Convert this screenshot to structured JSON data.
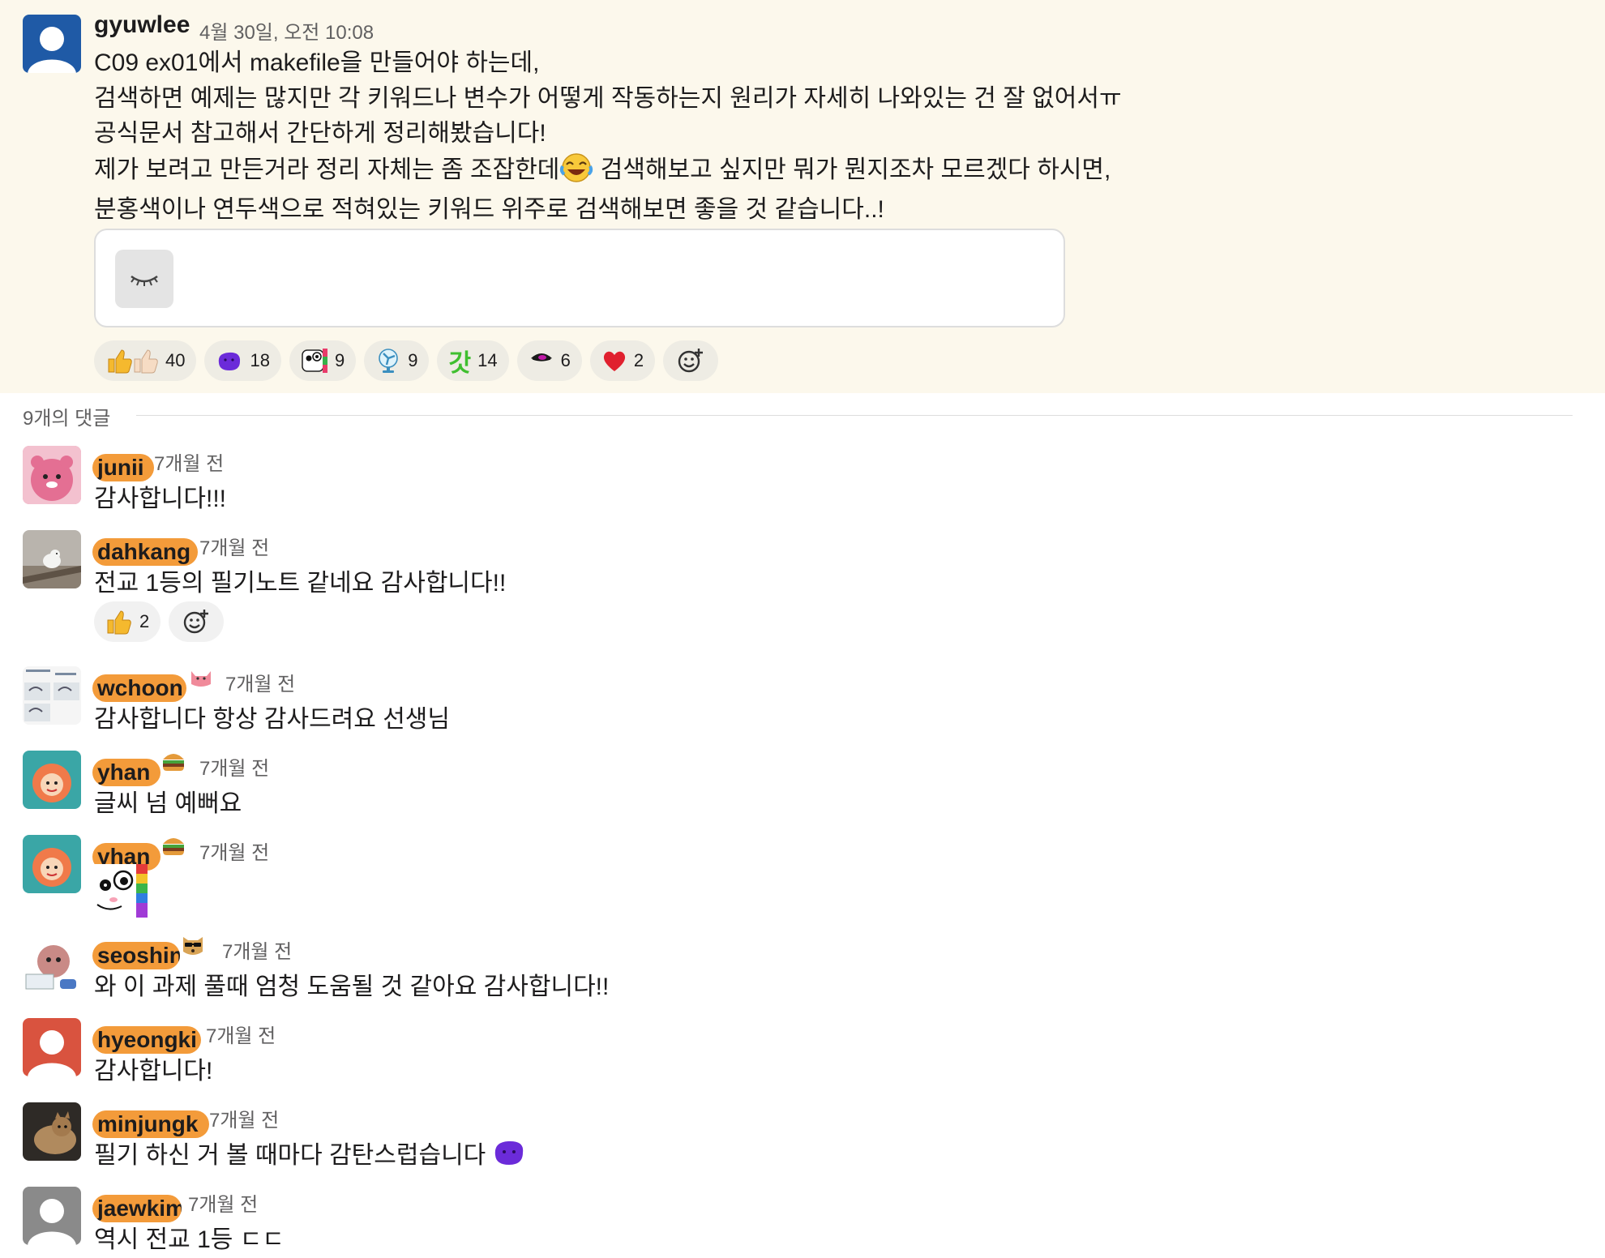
{
  "post": {
    "author": "gyuwlee",
    "timestamp": "4월 30일, 오전 10:08",
    "lines": [
      "C09 ex01에서 makefile을 만들어야 하는데,",
      "검색하면 예제는 많지만 각 키워드나 변수가 어떻게 작동하는지 원리가 자세히 나와있는 건 잘 없어서ㅠ",
      "공식문서 참고해서 간단하게 정리해봤습니다!",
      "제가 보려고 만든거라 정리 자체는 좀 조잡한데",
      " 검색해보고 싶지만 뭐가 뭔지조차 모르겠다 하시면,",
      "분홍색이나 연두색으로 적혀있는 키워드 위주로 검색해보면 좋을 것 같습니다..!"
    ],
    "inline_emoji_icon": "joy-face-icon",
    "attachment_icon": "hidden-eye-icon",
    "reactions": [
      {
        "icon": "thumbs-up-two-tone-icon",
        "count": "40"
      },
      {
        "icon": "purple-blob-icon",
        "count": "18"
      },
      {
        "icon": "crazy-face-icon",
        "count": "9"
      },
      {
        "icon": "fan-icon",
        "count": "9"
      },
      {
        "icon": "gat-text-icon",
        "glyph": "갓",
        "count": "14"
      },
      {
        "icon": "peeking-eye-icon",
        "count": "6"
      },
      {
        "icon": "red-heart-icon",
        "count": "2"
      }
    ],
    "add_reaction_icon": "add-reaction-icon"
  },
  "thread": {
    "reply_count_label": "9개의 댓글"
  },
  "replies": [
    {
      "name": "junii",
      "time": "7개월 전",
      "text": "감사합니다!!!",
      "avatar": "pink-character-avatar"
    },
    {
      "name": "dahkang",
      "time": "7개월 전",
      "text": "전교 1등의 필기노트 같네요 감사합니다!!",
      "avatar": "bird-photo-avatar",
      "reactions": [
        {
          "icon": "thumbs-up-icon",
          "count": "2"
        }
      ]
    },
    {
      "name": "wchoon",
      "time": "7개월 전",
      "text": "감사합니다 항상 감사드려요 선생님",
      "avatar": "sketch-avatar",
      "status_icon": "pink-cat-icon"
    },
    {
      "name": "yhan",
      "time": "7개월 전",
      "text": "글씨 넘 예뻐요",
      "avatar": "ponyo-avatar",
      "status_icon": "hamburger-icon"
    },
    {
      "name": "yhan",
      "time": "7개월 전",
      "text": "",
      "avatar": "ponyo-avatar",
      "status_icon": "hamburger-icon",
      "sticker_icon": "crazy-face-sticker-icon"
    },
    {
      "name": "seoshin",
      "time": "7개월 전",
      "text": "와 이 과제 풀때 엄청 도움될 것 같아요 감사합니다!!",
      "avatar": "character-laptop-avatar",
      "status_icon": "cool-dog-icon"
    },
    {
      "name": "hyeongki",
      "time": "7개월 전",
      "text": "감사합니다!",
      "avatar": "default-red-avatar"
    },
    {
      "name": "minjungk",
      "time": "7개월 전",
      "text": "필기 하신 거 볼 때마다 감탄스럽습니다",
      "avatar": "cat-photo-avatar",
      "trailing_icon": "purple-blob-icon"
    },
    {
      "name": "jaewkim",
      "time": "7개월 전",
      "text": "역시 전교 1등 ㄷㄷ",
      "avatar": "default-gray-avatar"
    }
  ],
  "colors": {
    "highlight_bg": "#fcf8ec",
    "name_redaction": "#f39b3a",
    "text": "#1d1c1d",
    "muted": "#616061"
  }
}
